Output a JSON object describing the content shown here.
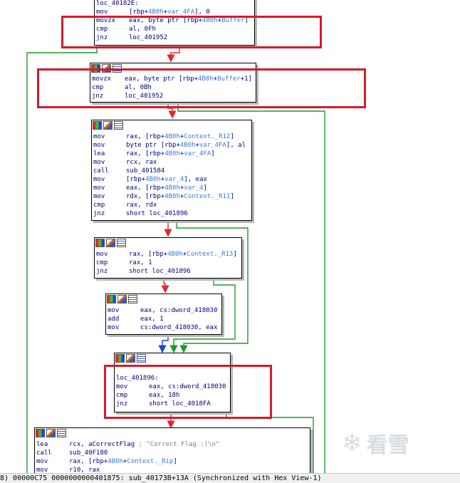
{
  "blocks": [
    {
      "id": "b0",
      "lines": [
        {
          "m": "loc_40182E:",
          "o": []
        },
        {
          "m": "mov",
          "o": [
            {
              "t": "[rbp+"
            },
            {
              "t": "4B0h",
              "h": 1
            },
            {
              "t": "+"
            },
            {
              "t": "var_4FA",
              "h": 1
            },
            {
              "t": "], 0"
            }
          ]
        },
        {
          "m": "movzx",
          "o": [
            {
              "t": "eax, byte ptr [rbp+"
            },
            {
              "t": "4B0h",
              "h": 1
            },
            {
              "t": "+"
            },
            {
              "t": "Buffer",
              "h": 1
            },
            {
              "t": "]"
            }
          ]
        },
        {
          "m": "cmp",
          "o": [
            {
              "t": "al, 0Fh"
            }
          ]
        },
        {
          "m": "jnz",
          "o": [
            {
              "t": "loc_401952"
            }
          ]
        }
      ]
    },
    {
      "id": "b1",
      "lines": [
        {
          "m": "movzx",
          "o": [
            {
              "t": "eax, byte ptr [rbp+"
            },
            {
              "t": "4B0h",
              "h": 1
            },
            {
              "t": "+"
            },
            {
              "t": "Buffer",
              "h": 1
            },
            {
              "t": "+1]"
            }
          ]
        },
        {
          "m": "cmp",
          "o": [
            {
              "t": "al, 0Bh"
            }
          ]
        },
        {
          "m": "jnz",
          "o": [
            {
              "t": "loc_401952"
            }
          ]
        }
      ]
    },
    {
      "id": "b2",
      "lines": [
        {
          "m": "mov",
          "o": [
            {
              "t": "rax, [rbp+"
            },
            {
              "t": "4B0h",
              "h": 1
            },
            {
              "t": "+"
            },
            {
              "t": "Context._R12",
              "h": 1
            },
            {
              "t": "]"
            }
          ]
        },
        {
          "m": "mov",
          "o": [
            {
              "t": "byte ptr [rbp+"
            },
            {
              "t": "4B0h",
              "h": 1
            },
            {
              "t": "+"
            },
            {
              "t": "var_4FA",
              "h": 1
            },
            {
              "t": "], al"
            }
          ]
        },
        {
          "m": "lea",
          "o": [
            {
              "t": "rax, [rbp+"
            },
            {
              "t": "4B0h",
              "h": 1
            },
            {
              "t": "+"
            },
            {
              "t": "var_4FA",
              "h": 1
            },
            {
              "t": "]"
            }
          ]
        },
        {
          "m": "mov",
          "o": [
            {
              "t": "rcx, rax"
            }
          ]
        },
        {
          "m": "call",
          "o": [
            {
              "t": "sub_401584"
            }
          ]
        },
        {
          "m": "mov",
          "o": [
            {
              "t": "[rbp+"
            },
            {
              "t": "4B0h",
              "h": 1
            },
            {
              "t": "+"
            },
            {
              "t": "var_4",
              "h": 1
            },
            {
              "t": "], eax"
            }
          ]
        },
        {
          "m": "mov",
          "o": [
            {
              "t": "eax, [rbp+"
            },
            {
              "t": "4B0h",
              "h": 1
            },
            {
              "t": "+"
            },
            {
              "t": "var_4",
              "h": 1
            },
            {
              "t": "]"
            }
          ]
        },
        {
          "m": "mov",
          "o": [
            {
              "t": "rdx, [rbp+"
            },
            {
              "t": "4B0h",
              "h": 1
            },
            {
              "t": "+"
            },
            {
              "t": "Context._R11",
              "h": 1
            },
            {
              "t": "]"
            }
          ]
        },
        {
          "m": "cmp",
          "o": [
            {
              "t": "rax, rdx"
            }
          ]
        },
        {
          "m": "jnz",
          "o": [
            {
              "t": "short loc_401896"
            }
          ]
        }
      ]
    },
    {
      "id": "b3",
      "lines": [
        {
          "m": "mov",
          "o": [
            {
              "t": "rax, [rbp+"
            },
            {
              "t": "4B0h",
              "h": 1
            },
            {
              "t": "+"
            },
            {
              "t": "Context._R13",
              "h": 1
            },
            {
              "t": "]"
            }
          ]
        },
        {
          "m": "cmp",
          "o": [
            {
              "t": "rax, 1"
            }
          ]
        },
        {
          "m": "jnz",
          "o": [
            {
              "t": "short loc_401896"
            }
          ]
        }
      ]
    },
    {
      "id": "b4",
      "lines": [
        {
          "m": "mov",
          "o": [
            {
              "t": "eax, cs:dword_418030"
            }
          ]
        },
        {
          "m": "add",
          "o": [
            {
              "t": "eax, 1"
            }
          ]
        },
        {
          "m": "mov",
          "o": [
            {
              "t": "cs:dword_418030, eax"
            }
          ]
        }
      ]
    },
    {
      "id": "b5",
      "lines": [
        {
          "m": "",
          "o": []
        },
        {
          "m": "loc_401896:",
          "o": []
        },
        {
          "m": "mov",
          "o": [
            {
              "t": "eax, cs:dword_418030"
            }
          ]
        },
        {
          "m": "cmp",
          "o": [
            {
              "t": "eax, 18h"
            }
          ]
        },
        {
          "m": "jnz",
          "o": [
            {
              "t": "short loc_4018FA"
            }
          ]
        }
      ]
    },
    {
      "id": "b6",
      "lines": [
        {
          "m": "lea",
          "o": [
            {
              "t": "rcx, aCorrectFlag"
            },
            {
              "t": " ; \"Correct Flag :)\\n\"",
              "c": 1
            }
          ]
        },
        {
          "m": "call",
          "o": [
            {
              "t": "sub_40F180"
            }
          ]
        },
        {
          "m": "mov",
          "o": [
            {
              "t": "rax, [rbp+"
            },
            {
              "t": "4B0h",
              "h": 1
            },
            {
              "t": "+"
            },
            {
              "t": "Context._Rip",
              "h": 1
            },
            {
              "t": "]"
            }
          ]
        },
        {
          "m": "mov",
          "o": [
            {
              "t": "r10, rax"
            }
          ]
        }
      ]
    }
  ],
  "watermark": {
    "text": "看雪"
  },
  "status_bar": {
    "text": "8) 00000C75 0000000000401875: sub_40173B+13A (Synchronized with Hex View-1)"
  },
  "colors": {
    "edge_red": "#e8262c",
    "edge_green": "#1b9a2a",
    "edge_blue": "#1746d6",
    "highlight_box": "#d51b2a"
  }
}
